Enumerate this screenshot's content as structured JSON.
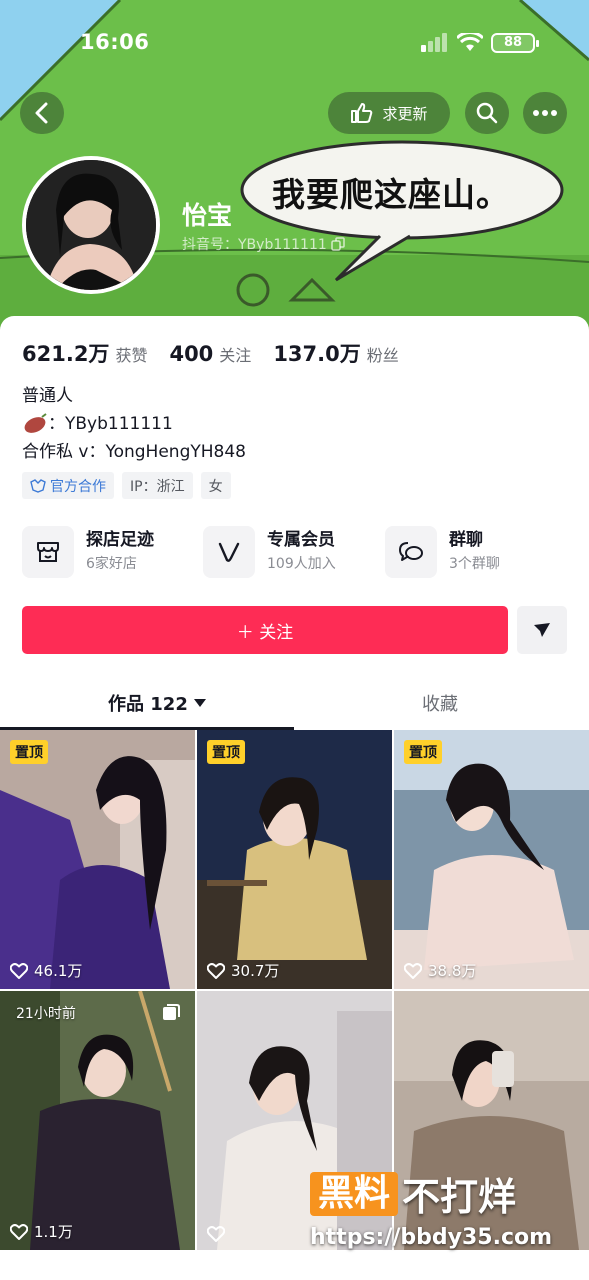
{
  "status_bar": {
    "time": "16:06",
    "battery": "88"
  },
  "header": {
    "update_label": "求更新",
    "nickname": "怡宝",
    "douyin_id_label": "抖音号：YByb111111",
    "bubble_text": "我要爬这座山。"
  },
  "stats": [
    {
      "value": "621.2万",
      "label": "获赞"
    },
    {
      "value": "400",
      "label": "关注"
    },
    {
      "value": "137.0万",
      "label": "粉丝"
    }
  ],
  "bio": {
    "line1": "普通人",
    "line2": "：YByb111111",
    "line3": "合作私 v：YongHengYH848"
  },
  "tags": [
    {
      "label": "官方合作"
    },
    {
      "label": "IP：浙江"
    },
    {
      "label": "女"
    }
  ],
  "services": [
    {
      "title": "探店足迹",
      "sub": "6家好店",
      "icon": "store-icon"
    },
    {
      "title": "专属会员",
      "sub": "109人加入",
      "icon": "v-member-icon"
    },
    {
      "title": "群聊",
      "sub": "3个群聊",
      "icon": "chat-group-icon"
    }
  ],
  "actions": {
    "follow_label": "＋ 关注"
  },
  "tabs": {
    "works": "作品 122",
    "favorites": "收藏"
  },
  "videos": [
    {
      "pinned": "置顶",
      "likes": "46.1万"
    },
    {
      "pinned": "置顶",
      "likes": "30.7万"
    },
    {
      "pinned": "置顶",
      "likes": "38.8万"
    },
    {
      "time_ago": "21小时前",
      "likes": "1.1万"
    },
    {
      "likes": ""
    },
    {
      "likes": ""
    }
  ],
  "watermark": {
    "brand_box": "黑料",
    "brand_rest": "不打烊",
    "url": "https://bbdy35.com"
  },
  "colors": {
    "accent": "#fe2c55",
    "pin": "#ffd02a",
    "official": "#3d7ad6"
  }
}
